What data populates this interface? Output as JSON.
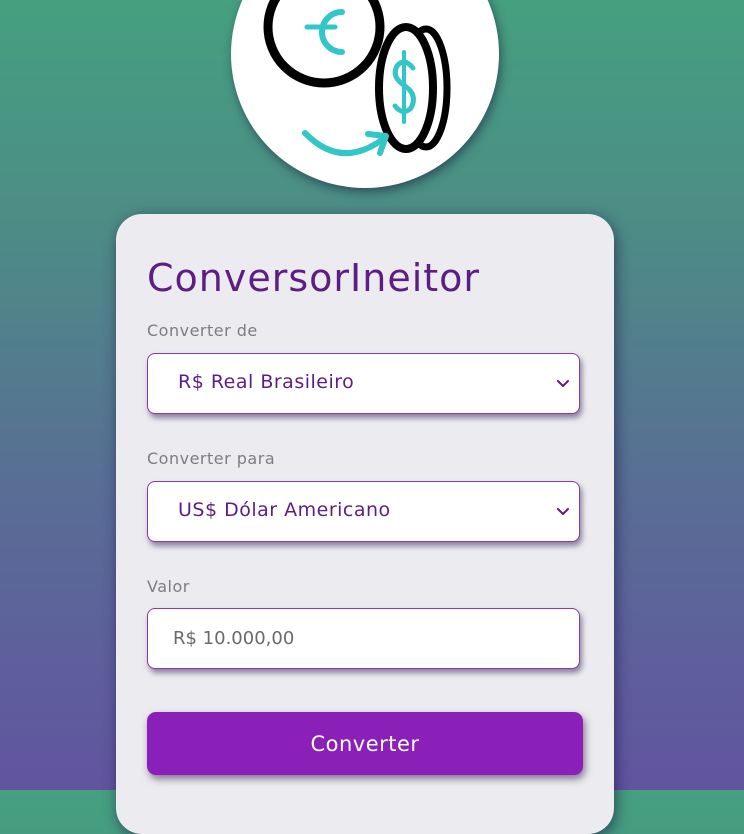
{
  "logo": {
    "icon": "currency-exchange-icon",
    "colors": {
      "outline": "#000000",
      "accent": "#33c6c8"
    }
  },
  "card": {
    "title": "ConversorIneitor"
  },
  "from": {
    "label": "Converter de",
    "selected": "R$ Real Brasileiro"
  },
  "to": {
    "label": "Converter para",
    "selected": "US$ Dólar Americano"
  },
  "amount": {
    "label": "Valor",
    "placeholder": "R$ 10.000,00"
  },
  "button": {
    "label": "Converter"
  },
  "colors": {
    "background_top": "#45a07f",
    "background_bottom": "#6254a0",
    "card": "#ececf0",
    "title": "#5e1d83",
    "label": "#7d7d7d",
    "field_border": "#8a3aa8",
    "button": "#8a20b8"
  }
}
